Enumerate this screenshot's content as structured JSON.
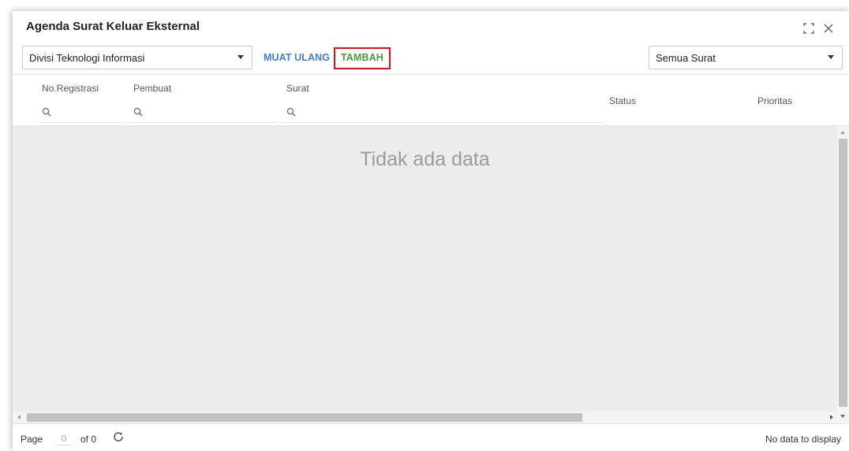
{
  "window": {
    "title": "Agenda Surat Keluar Eksternal",
    "maximize_icon": "maximize-icon",
    "close_icon": "close-icon"
  },
  "toolbar": {
    "division_select": {
      "value": "Divisi Teknologi Informasi",
      "icon": "chevron-down-icon"
    },
    "reload_label": "MUAT ULANG",
    "add_label": "TAMBAH",
    "filter_select": {
      "value": "Semua Surat",
      "icon": "chevron-down-icon"
    }
  },
  "grid": {
    "columns": [
      {
        "key": "no_registrasi",
        "label": "No.Registrasi",
        "searchable": true
      },
      {
        "key": "pembuat",
        "label": "Pembuat",
        "searchable": true
      },
      {
        "key": "surat",
        "label": "Surat",
        "searchable": true
      },
      {
        "key": "status",
        "label": "Status",
        "searchable": false
      },
      {
        "key": "prioritas",
        "label": "Prioritas",
        "searchable": false
      }
    ],
    "rows": [],
    "empty_message": "Tidak ada data"
  },
  "pager": {
    "page_label": "Page",
    "page_value": "0",
    "of_label": "of 0",
    "refresh_icon": "refresh-icon",
    "status": "No data to display"
  },
  "colors": {
    "reload": "#3e7ed6",
    "add": "#4a9a3c",
    "highlight": "#e1111b",
    "grid_body": "#ececec"
  }
}
